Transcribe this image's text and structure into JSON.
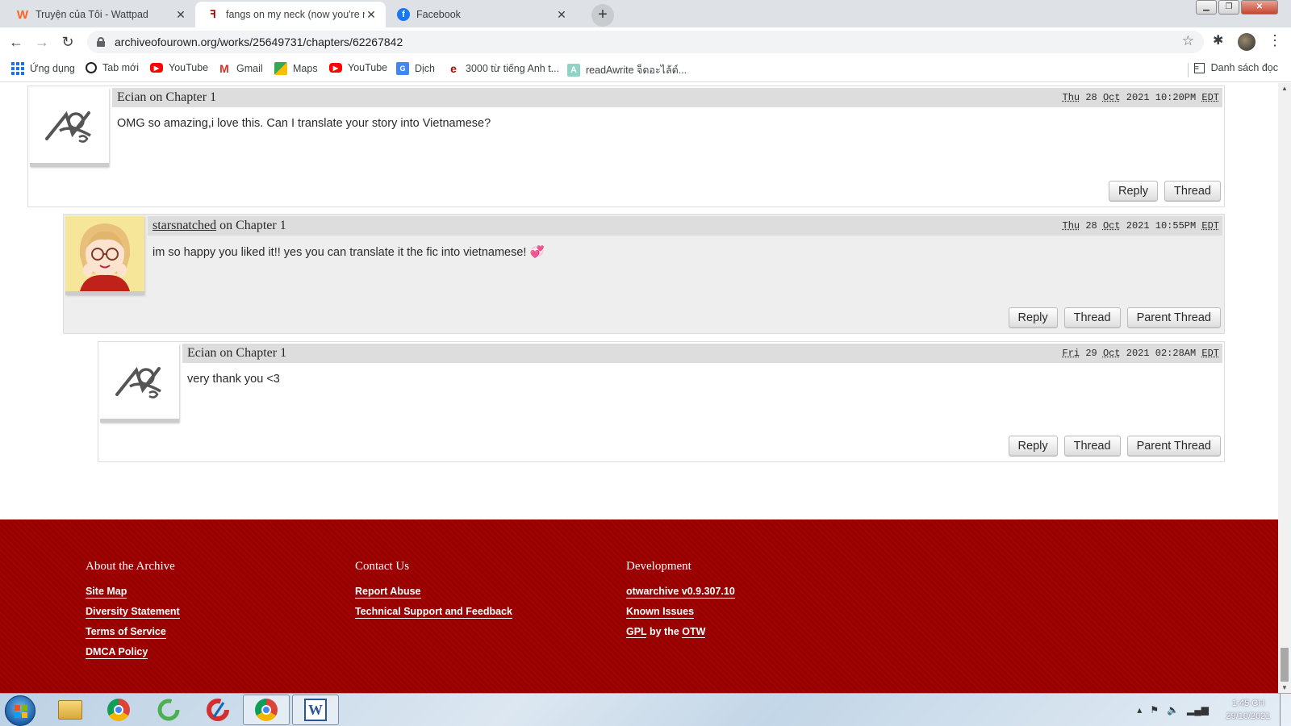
{
  "browser": {
    "tabs": [
      {
        "title": "Truyện của Tôi - Wattpad",
        "icon": "wattpad-icon",
        "color": "#ff6122"
      },
      {
        "title": "fangs on my neck (now you're m",
        "icon": "ao3-icon",
        "color": "#990000"
      },
      {
        "title": "Facebook",
        "icon": "facebook-icon",
        "color": "#1877f2"
      }
    ],
    "new_tab": "+",
    "url": "archiveofourown.org/works/25649731/chapters/62267842",
    "bookmarks": [
      {
        "label": "Ứng dụng",
        "icon": "apps-grid-icon"
      },
      {
        "label": "Tab mới",
        "icon": "globe-icon"
      },
      {
        "label": "YouTube",
        "icon": "youtube-icon"
      },
      {
        "label": "Gmail",
        "icon": "gmail-icon"
      },
      {
        "label": "Maps",
        "icon": "maps-icon"
      },
      {
        "label": "YouTube",
        "icon": "youtube-icon"
      },
      {
        "label": "Dịch",
        "icon": "translate-icon"
      },
      {
        "label": "3000 từ tiếng Anh t...",
        "icon": "e-icon"
      },
      {
        "label": "readAwrite จ็ดอะไล้ต์...",
        "icon": "readawrite-icon"
      }
    ],
    "reading_list": "Danh sách đọc"
  },
  "comments": [
    {
      "author": "Ecian",
      "author_linked": false,
      "on": "on Chapter 1",
      "date": {
        "day": "Thu",
        "date": "28",
        "month": "Oct",
        "year": "2021",
        "time": "10:20PM",
        "tz": "EDT"
      },
      "body": "OMG so amazing,i love this. Can I translate your story into Vietnamese?",
      "avatar": "default-ao3-avatar",
      "buttons": [
        "Reply",
        "Thread"
      ]
    },
    {
      "author": "starsnatched",
      "author_linked": true,
      "on": "on Chapter 1",
      "date": {
        "day": "Thu",
        "date": "28",
        "month": "Oct",
        "year": "2021",
        "time": "10:55PM",
        "tz": "EDT"
      },
      "body": "im so happy you liked it!! yes you can translate it the fic into vietnamese! 💞",
      "avatar": "illustrated-girl-avatar",
      "buttons": [
        "Reply",
        "Thread",
        "Parent Thread"
      ]
    },
    {
      "author": "Ecian",
      "author_linked": false,
      "on": "on Chapter 1",
      "date": {
        "day": "Fri",
        "date": "29",
        "month": "Oct",
        "year": "2021",
        "time": "02:28AM",
        "tz": "EDT"
      },
      "body": "very thank you <3",
      "avatar": "default-ao3-avatar",
      "buttons": [
        "Reply",
        "Thread",
        "Parent Thread"
      ]
    }
  ],
  "footer": {
    "columns": [
      {
        "heading": "About the Archive",
        "links": [
          "Site Map",
          "Diversity Statement",
          "Terms of Service",
          "DMCA Policy"
        ]
      },
      {
        "heading": "Contact Us",
        "links": [
          "Report Abuse",
          "Technical Support and Feedback"
        ]
      },
      {
        "heading": "Development",
        "links": [
          "otwarchive v0.9.307.10",
          "Known Issues"
        ],
        "gpl": {
          "a": "GPL",
          "mid": "by the",
          "b": "OTW"
        }
      }
    ],
    "bg_color": "#990000"
  },
  "taskbar": {
    "items": [
      "windows-explorer-icon",
      "chrome-icon",
      "ccleaner-green-icon",
      "ccleaner-icon",
      "chrome-icon",
      "word-icon"
    ],
    "clock_time": "1:45 CH",
    "clock_date": "29/10/2021"
  }
}
